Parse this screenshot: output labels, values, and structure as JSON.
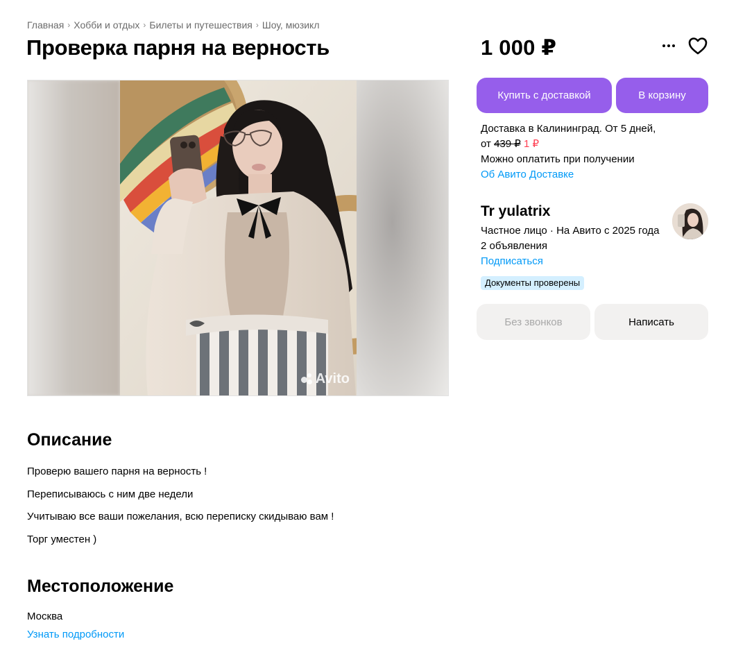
{
  "breadcrumbs": [
    "Главная",
    "Хобби и отдых",
    "Билеты и путешествия",
    "Шоу, мюзикл"
  ],
  "title": "Проверка парня на верность",
  "price": "1 000 ₽",
  "gallery": {
    "watermark": "Avito"
  },
  "actions": {
    "buy_label": "Купить с доставкой",
    "cart_label": "В корзину"
  },
  "delivery": {
    "line1": "Доставка в Калининград. От 5 дней,",
    "from_prefix": "от",
    "old_price": "439 ₽",
    "new_price": "1 ₽",
    "payment_note": "Можно оплатить при получении",
    "about_link": "Об Авито Доставке"
  },
  "seller": {
    "name": "Tr yulatrix",
    "info": "Частное лицо · На Авито с 2025 года",
    "ads_count": "2 объявления",
    "subscribe_link": "Подписаться",
    "badge": "Документы проверены"
  },
  "contact": {
    "no_calls_label": "Без звонков",
    "write_label": "Написать"
  },
  "description": {
    "heading": "Описание",
    "lines": [
      "Проверю вашего парня на верность !",
      "Переписываюсь с ним две недели",
      "Учитываю все ваши пожелания, всю переписку скидываю вам !",
      "Торг уместен )"
    ]
  },
  "location": {
    "heading": "Местоположение",
    "city": "Москва",
    "details_link": "Узнать подробности"
  },
  "colors": {
    "accent": "#965eeb",
    "link": "#0099f7",
    "sale": "#ff4053",
    "badge_bg": "#d4efff"
  }
}
